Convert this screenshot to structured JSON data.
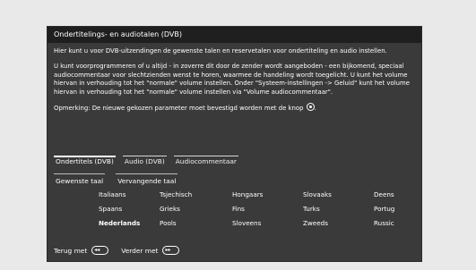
{
  "window": {
    "title": "Ondertitelings- en audiotalen (DVB)"
  },
  "intro": {
    "line1": "Hier kunt u voor DVB-uitzendingen de gewenste talen en reservetalen voor ondertiteling en audio instellen.",
    "line2": "U kunt voorprogrammeren of u altijd - in zoverre dit door de zender wordt aangeboden - een bijkomend, speciaal audiocommentaar voor slechtzienden wenst te horen, waarmee de handeling wordt toegelicht. U kunt het volume hiervan in verhouding tot het \"normale\" volume instellen. Onder \"Systeem-instellingen -> Geluid\" kunt het volume hiervan in verhouding tot het \"normale\" volume instellen via \"Volume audiocommentaar\".",
    "note": "Opmerking: De nieuwe gekozen parameter moet bevestigd worden met de knop"
  },
  "tabs": [
    {
      "label": "Ondertitels (DVB)",
      "active": true
    },
    {
      "label": "Audio (DVB)",
      "active": false
    },
    {
      "label": "Audiocommentaar",
      "active": false
    }
  ],
  "subtabs": [
    {
      "label": "Gewenste taal",
      "active": true
    },
    {
      "label": "Vervangende taal",
      "active": false
    }
  ],
  "languages": {
    "rows": [
      [
        "Italiaans",
        "Tsjechisch",
        "Hongaars",
        "Slovaaks",
        "Deens"
      ],
      [
        "Spaans",
        "Grieks",
        "Fins",
        "Turks",
        "Portug"
      ],
      [
        "Nederlands",
        "Pools",
        "Sloveens",
        "Zweeds",
        "Russic"
      ]
    ],
    "selected": "Nederlands"
  },
  "footer": {
    "back_label": "Terug met",
    "next_label": "Verder met"
  },
  "colors": {
    "panel": "#3a3a3a",
    "titlebar": "#1f1f1f",
    "text": "#ffffff",
    "page_bg": "#e9e9e9"
  }
}
